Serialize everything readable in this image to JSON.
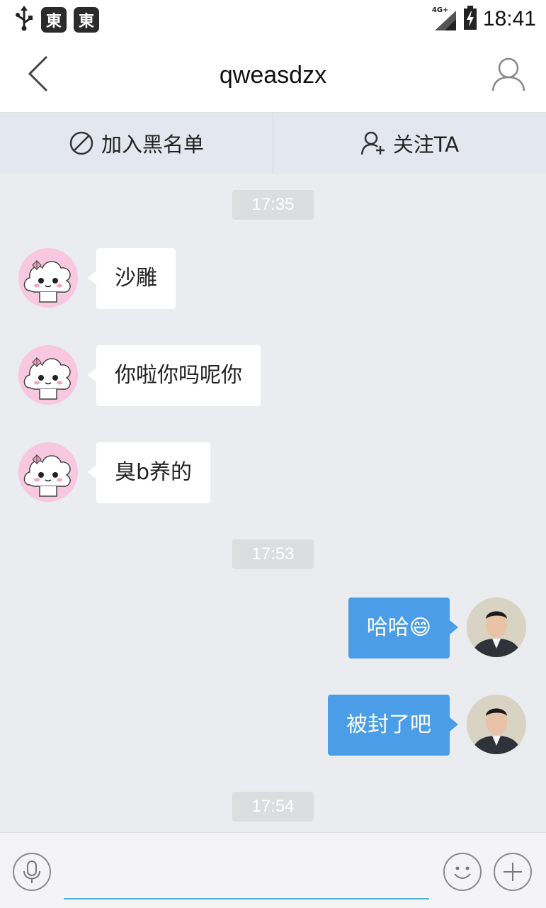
{
  "status_bar": {
    "time": "18:41",
    "network": "4G+",
    "app_badge_1": "東",
    "app_badge_2": "東"
  },
  "header": {
    "title": "qweasdzx"
  },
  "actions": {
    "blacklist_label": "加入黑名单",
    "follow_label": "关注TA"
  },
  "messages": {
    "time_1": "17:35",
    "in_1": "沙雕",
    "in_2": "你啦你吗呢你",
    "in_3": "臭b养的",
    "time_2": "17:53",
    "out_1": "哈哈😄",
    "out_2": "被封了吧",
    "time_3": "17:54"
  },
  "input": {
    "placeholder": ""
  },
  "colors": {
    "outgoing_bubble": "#4a9de6",
    "incoming_bubble": "#ffffff",
    "chat_background": "#ebecf0",
    "action_bar": "#e3e8f0",
    "input_underline": "#4db6d6"
  },
  "icons": [
    "usb-icon",
    "back-arrow-icon",
    "profile-icon",
    "block-icon",
    "add-user-icon",
    "microphone-icon",
    "emoji-icon",
    "plus-icon",
    "signal-icon",
    "battery-icon"
  ]
}
